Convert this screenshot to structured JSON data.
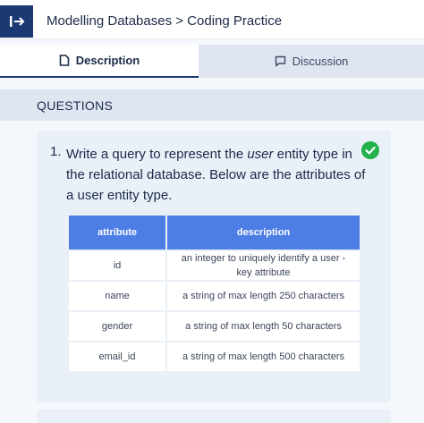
{
  "header": {
    "breadcrumb": "Modelling Databases > Coding Practice",
    "collapse_icon": "sidebar-collapse-icon",
    "accent": "#1b3a73"
  },
  "tabs": [
    {
      "label": "Description",
      "icon": "document-icon",
      "active": true
    },
    {
      "label": "Discussion",
      "icon": "chat-icon",
      "active": false
    }
  ],
  "questions": {
    "title": "QUESTIONS",
    "items": [
      {
        "number": "1.",
        "text_before": "Write a query to represent the ",
        "text_emphasis": "user",
        "text_after": " entity type in the relational database. Below are the attributes of a user entity type.",
        "status_icon": "check-circle-icon",
        "status_color": "#22b14c",
        "table": {
          "headers": [
            "attribute",
            "description"
          ],
          "rows": [
            [
              "id",
              "an integer to uniquely identify a user - key attribute"
            ],
            [
              "name",
              "a string of max length 250 characters"
            ],
            [
              "gender",
              "a string of max length 50 characters"
            ],
            [
              "email_id",
              "a string of max length 500 characters"
            ]
          ]
        }
      }
    ]
  }
}
